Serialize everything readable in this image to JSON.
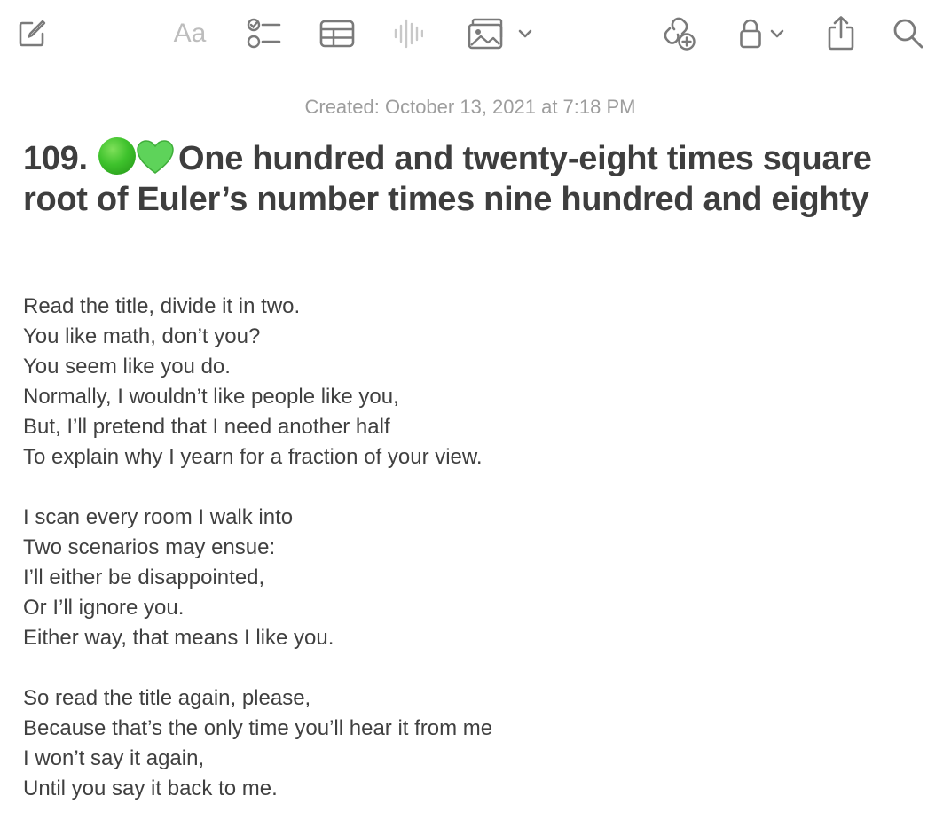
{
  "toolbar": {
    "items": [
      {
        "name": "compose",
        "icon": "compose-icon"
      },
      {
        "name": "format",
        "label": "Aa",
        "icon": "format-text-icon"
      },
      {
        "name": "checklist",
        "icon": "checklist-icon"
      },
      {
        "name": "table",
        "icon": "table-icon"
      },
      {
        "name": "audio",
        "icon": "waveform-icon"
      },
      {
        "name": "media",
        "icon": "photo-icon"
      },
      {
        "name": "collaborate",
        "icon": "collaborate-icon"
      },
      {
        "name": "lock",
        "icon": "lock-icon"
      },
      {
        "name": "share",
        "icon": "share-icon"
      },
      {
        "name": "search",
        "icon": "search-icon"
      }
    ]
  },
  "note": {
    "created": "Created: October 13, 2021 at 7:18 PM",
    "title_number": "109.",
    "title_text": "One hundred and twenty-eight times square root of Euler’s number times nine hundred and eighty",
    "stanzas": [
      [
        "Read the title, divide it in two.",
        "You like math, don’t you?",
        "You seem like you do.",
        "Normally, I wouldn’t like people like you,",
        "But, I’ll pretend that I need another half",
        "To explain why I yearn for a fraction of your view."
      ],
      [
        "I scan every room I walk into",
        "Two scenarios may ensue:",
        "I’ll either be disappointed,",
        "Or I’ll ignore you.",
        "Either way, that means I like you."
      ],
      [
        "So read the title again, please,",
        "Because that’s the only time you’ll hear it from me",
        "I won’t say it again,",
        "Until you say it back to me."
      ]
    ]
  },
  "colors": {
    "icon": "#7a7a7a",
    "icon_disabled": "#bdbdbd",
    "title": "#3e3e3e",
    "body": "#404040",
    "meta": "#9d9d9d",
    "green_circle": "#3ec22c",
    "green_heart": "#5ed35a"
  }
}
